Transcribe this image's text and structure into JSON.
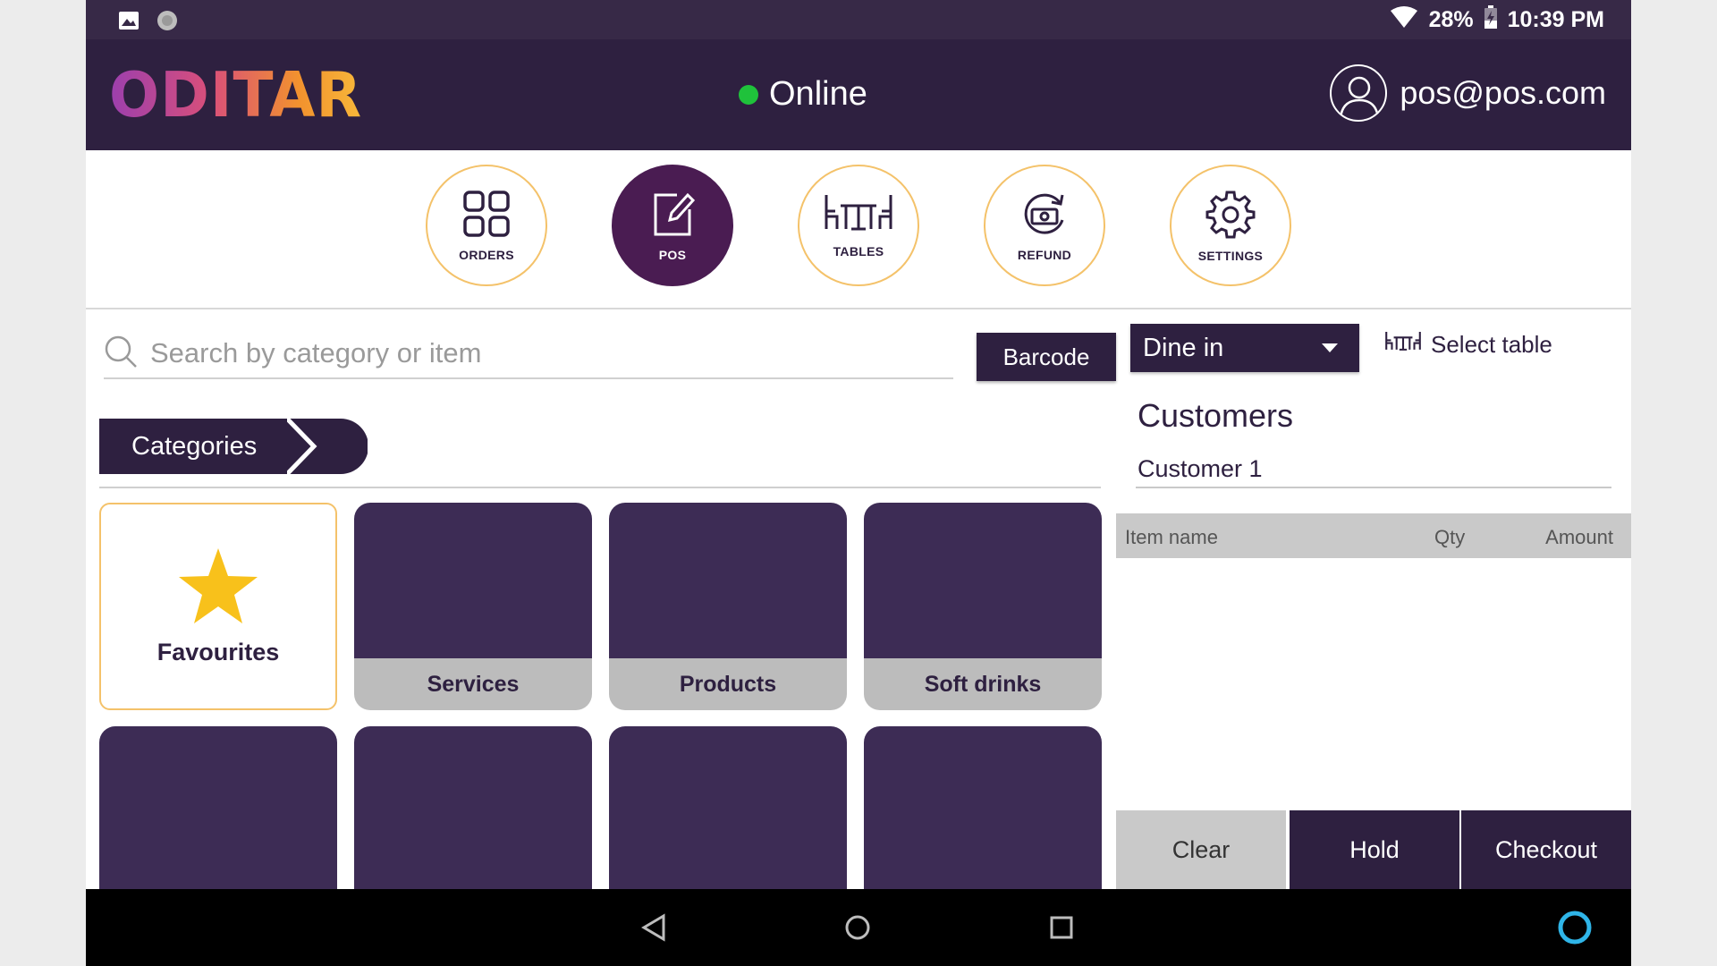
{
  "status_bar": {
    "battery": "28%",
    "time": "10:39 PM"
  },
  "header": {
    "logo": "ODITAR",
    "connection_status": "Online",
    "account_email": "pos@pos.com"
  },
  "nav": [
    {
      "label": "ORDERS",
      "icon": "grid-icon",
      "active": false
    },
    {
      "label": "POS",
      "icon": "edit-icon",
      "active": true
    },
    {
      "label": "TABLES",
      "icon": "table-icon",
      "active": false
    },
    {
      "label": "REFUND",
      "icon": "refund-icon",
      "active": false
    },
    {
      "label": "SETTINGS",
      "icon": "gear-icon",
      "active": false
    }
  ],
  "search": {
    "placeholder": "Search by category or item"
  },
  "barcode_label": "Barcode",
  "categories_label": "Categories",
  "tiles": [
    {
      "label": "Favourites",
      "icon": "star-icon"
    },
    {
      "label": "Services"
    },
    {
      "label": "Products"
    },
    {
      "label": "Soft drinks"
    }
  ],
  "order": {
    "type_selected": "Dine in",
    "select_table_label": "Select table",
    "customers_title": "Customers",
    "customer_value": "Customer 1",
    "columns": [
      "Item name",
      "Qty",
      "Amount"
    ]
  },
  "actions": {
    "clear": "Clear",
    "hold": "Hold",
    "checkout": "Checkout"
  },
  "colors": {
    "header_bg": "#2e2040",
    "accent_active": "#4a1c52",
    "ring": "#f4c26a",
    "tile_bg": "#3d2c55",
    "online": "#1fc23b",
    "star": "#f8c11b"
  }
}
